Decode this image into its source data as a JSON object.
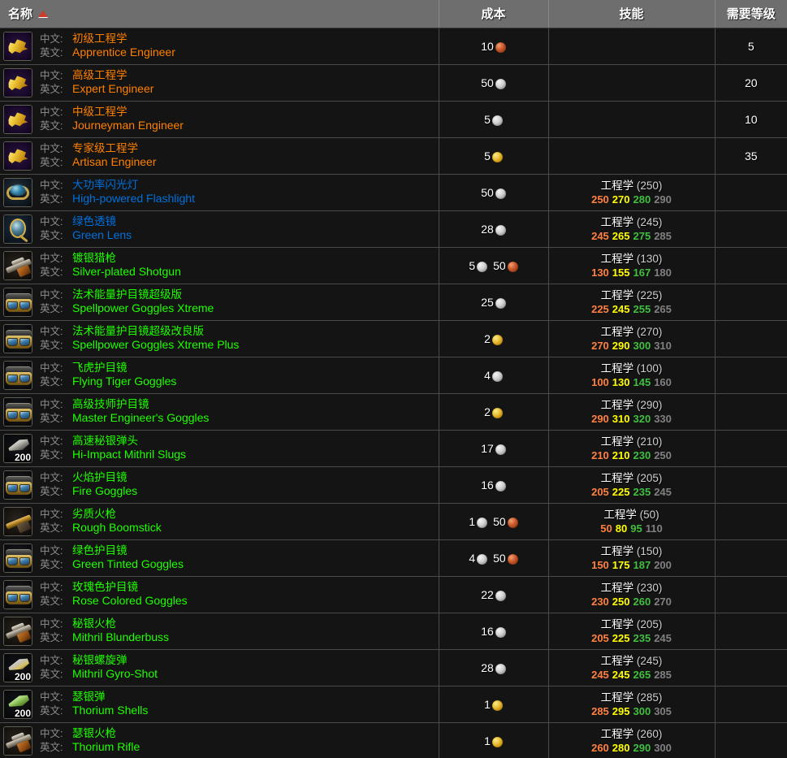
{
  "header": {
    "columns": [
      {
        "label": "名称",
        "sort": "asc",
        "align": "left"
      },
      {
        "label": "成本",
        "align": "center"
      },
      {
        "label": "技能",
        "align": "center"
      },
      {
        "label": "需要等级",
        "align": "center"
      }
    ]
  },
  "labels": {
    "cn": "中文:",
    "en": "英文:"
  },
  "skill_name": "工程学",
  "rank_colors": {
    "orange": "#ff8040",
    "yellow": "#ffff00",
    "green": "#40bf40",
    "gray": "#808080"
  },
  "quality_colors": {
    "poor": "#9d9d9d",
    "common": "#ffffff",
    "uncommon": "#1eff00",
    "rare": "#0070dd",
    "epic": "#a335ee",
    "legendary": "#ff8000"
  },
  "currency_colors": {
    "gold": "#d9a21b",
    "silver": "#c0c0c0",
    "copper": "#c9562a"
  },
  "rows": [
    {
      "icon": "gear-icon",
      "stack": "",
      "cn": "初级工程学",
      "en": "Apprentice Engineer",
      "quality": "legendary",
      "cost": [
        {
          "amount": "10",
          "coin": "copper"
        }
      ],
      "skill": null,
      "level": "5"
    },
    {
      "icon": "gear-icon",
      "stack": "",
      "cn": "高级工程学",
      "en": "Expert Engineer",
      "quality": "legendary",
      "cost": [
        {
          "amount": "50",
          "coin": "silver"
        }
      ],
      "skill": null,
      "level": "20"
    },
    {
      "icon": "gear-icon",
      "stack": "",
      "cn": "中级工程学",
      "en": "Journeyman Engineer",
      "quality": "legendary",
      "cost": [
        {
          "amount": "5",
          "coin": "silver"
        }
      ],
      "skill": null,
      "level": "10"
    },
    {
      "icon": "gear-icon",
      "stack": "",
      "cn": "专家级工程学",
      "en": "Artisan Engineer",
      "quality": "legendary",
      "cost": [
        {
          "amount": "5",
          "coin": "gold"
        }
      ],
      "skill": null,
      "level": "35"
    },
    {
      "icon": "flashlight-icon",
      "stack": "",
      "cn": "大功率闪光灯",
      "en": "High-powered Flashlight",
      "quality": "rare",
      "cost": [
        {
          "amount": "50",
          "coin": "silver"
        }
      ],
      "skill": {
        "req": "250",
        "ranks": [
          "250",
          "270",
          "280",
          "290"
        ]
      },
      "level": ""
    },
    {
      "icon": "lens-icon",
      "stack": "",
      "cn": "绿色透镜",
      "en": "Green Lens",
      "quality": "rare",
      "cost": [
        {
          "amount": "28",
          "coin": "silver"
        }
      ],
      "skill": {
        "req": "245",
        "ranks": [
          "245",
          "265",
          "275",
          "285"
        ]
      },
      "level": ""
    },
    {
      "icon": "shotgun-icon",
      "stack": "",
      "cn": "镀银猎枪",
      "en": "Silver-plated Shotgun",
      "quality": "uncommon",
      "cost": [
        {
          "amount": "5",
          "coin": "silver"
        },
        {
          "amount": "50",
          "coin": "copper"
        }
      ],
      "skill": {
        "req": "130",
        "ranks": [
          "130",
          "155",
          "167",
          "180"
        ]
      },
      "level": ""
    },
    {
      "icon": "goggles-icon",
      "stack": "",
      "cn": "法术能量护目镜超级版",
      "en": "Spellpower Goggles Xtreme",
      "quality": "uncommon",
      "cost": [
        {
          "amount": "25",
          "coin": "silver"
        }
      ],
      "skill": {
        "req": "225",
        "ranks": [
          "225",
          "245",
          "255",
          "265"
        ]
      },
      "level": ""
    },
    {
      "icon": "goggles-icon",
      "stack": "",
      "cn": "法术能量护目镜超级改良版",
      "en": "Spellpower Goggles Xtreme Plus",
      "quality": "uncommon",
      "cost": [
        {
          "amount": "2",
          "coin": "gold"
        }
      ],
      "skill": {
        "req": "270",
        "ranks": [
          "270",
          "290",
          "300",
          "310"
        ]
      },
      "level": ""
    },
    {
      "icon": "goggles-icon",
      "stack": "",
      "cn": "飞虎护目镜",
      "en": "Flying Tiger Goggles",
      "quality": "uncommon",
      "cost": [
        {
          "amount": "4",
          "coin": "silver"
        }
      ],
      "skill": {
        "req": "100",
        "ranks": [
          "100",
          "130",
          "145",
          "160"
        ]
      },
      "level": ""
    },
    {
      "icon": "goggles-icon",
      "stack": "",
      "cn": "高级技师护目镜",
      "en": "Master Engineer's Goggles",
      "quality": "uncommon",
      "cost": [
        {
          "amount": "2",
          "coin": "gold"
        }
      ],
      "skill": {
        "req": "290",
        "ranks": [
          "290",
          "310",
          "320",
          "330"
        ]
      },
      "level": ""
    },
    {
      "icon": "bullet-icon",
      "stack": "200",
      "cn": "高速秘银弹头",
      "en": "Hi-Impact Mithril Slugs",
      "quality": "uncommon",
      "cost": [
        {
          "amount": "17",
          "coin": "silver"
        }
      ],
      "skill": {
        "req": "210",
        "ranks": [
          "210",
          "210",
          "230",
          "250"
        ]
      },
      "level": ""
    },
    {
      "icon": "goggles-icon",
      "stack": "",
      "cn": "火焰护目镜",
      "en": "Fire Goggles",
      "quality": "uncommon",
      "cost": [
        {
          "amount": "16",
          "coin": "silver"
        }
      ],
      "skill": {
        "req": "205",
        "ranks": [
          "205",
          "225",
          "235",
          "245"
        ]
      },
      "level": ""
    },
    {
      "icon": "rough-gun-icon",
      "stack": "",
      "cn": "劣质火枪",
      "en": "Rough Boomstick",
      "quality": "uncommon",
      "cost": [
        {
          "amount": "1",
          "coin": "silver"
        },
        {
          "amount": "50",
          "coin": "copper"
        }
      ],
      "skill": {
        "req": "50",
        "ranks": [
          "50",
          "80",
          "95",
          "110"
        ]
      },
      "level": ""
    },
    {
      "icon": "goggles-icon",
      "stack": "",
      "cn": "绿色护目镜",
      "en": "Green Tinted Goggles",
      "quality": "uncommon",
      "cost": [
        {
          "amount": "4",
          "coin": "silver"
        },
        {
          "amount": "50",
          "coin": "copper"
        }
      ],
      "skill": {
        "req": "150",
        "ranks": [
          "150",
          "175",
          "187",
          "200"
        ]
      },
      "level": ""
    },
    {
      "icon": "goggles-icon",
      "stack": "",
      "cn": "玫瑰色护目镜",
      "en": "Rose Colored Goggles",
      "quality": "uncommon",
      "cost": [
        {
          "amount": "22",
          "coin": "silver"
        }
      ],
      "skill": {
        "req": "230",
        "ranks": [
          "230",
          "250",
          "260",
          "270"
        ]
      },
      "level": ""
    },
    {
      "icon": "shotgun-icon",
      "stack": "",
      "cn": "秘银火枪",
      "en": "Mithril Blunderbuss",
      "quality": "uncommon",
      "cost": [
        {
          "amount": "16",
          "coin": "silver"
        }
      ],
      "skill": {
        "req": "205",
        "ranks": [
          "205",
          "225",
          "235",
          "245"
        ]
      },
      "level": ""
    },
    {
      "icon": "gyro-bullet-icon",
      "stack": "200",
      "cn": "秘银螺旋弹",
      "en": "Mithril Gyro-Shot",
      "quality": "uncommon",
      "cost": [
        {
          "amount": "28",
          "coin": "silver"
        }
      ],
      "skill": {
        "req": "245",
        "ranks": [
          "245",
          "245",
          "265",
          "285"
        ]
      },
      "level": ""
    },
    {
      "icon": "thorium-bullet-icon",
      "stack": "200",
      "cn": "瑟银弹",
      "en": "Thorium Shells",
      "quality": "uncommon",
      "cost": [
        {
          "amount": "1",
          "coin": "gold"
        }
      ],
      "skill": {
        "req": "285",
        "ranks": [
          "285",
          "295",
          "300",
          "305"
        ]
      },
      "level": ""
    },
    {
      "icon": "shotgun-icon",
      "stack": "",
      "cn": "瑟银火枪",
      "en": "Thorium Rifle",
      "quality": "uncommon",
      "cost": [
        {
          "amount": "1",
          "coin": "gold"
        }
      ],
      "skill": {
        "req": "260",
        "ranks": [
          "260",
          "280",
          "290",
          "300"
        ]
      },
      "level": ""
    }
  ]
}
